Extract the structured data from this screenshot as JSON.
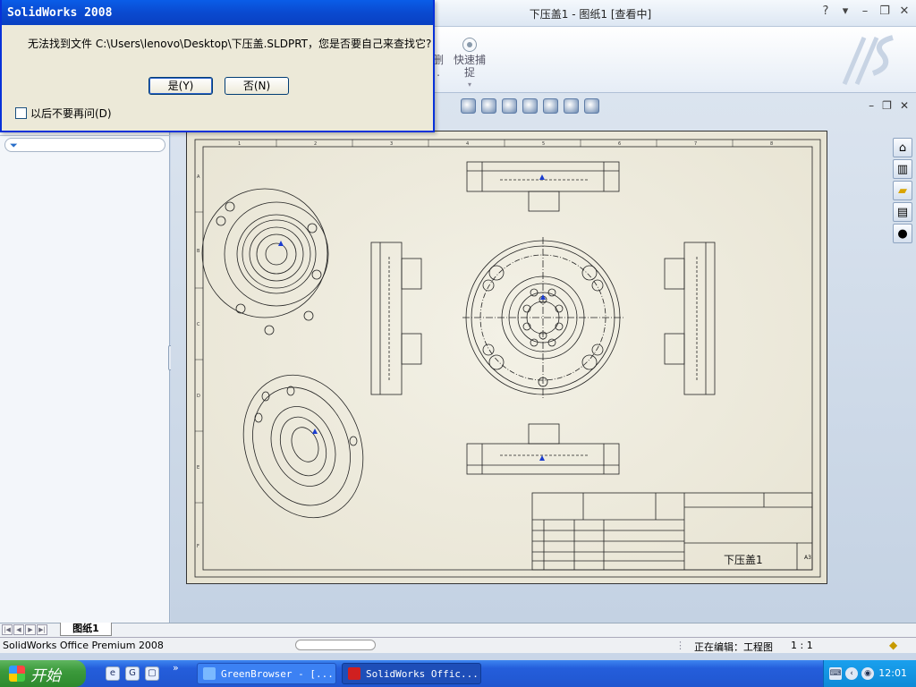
{
  "app": {
    "document_title": "下压盖1 - 图纸1 [查看中]",
    "window_controls": [
      "?",
      "▾",
      "–",
      "❐",
      "✕"
    ]
  },
  "ribbon": {
    "items": [
      {
        "label": "删\n.",
        "icon": "delete-icon"
      },
      {
        "label": "快速捕\n捉",
        "icon": "quick-snap-icon"
      }
    ]
  },
  "dialog": {
    "title": "SolidWorks 2008",
    "message": "无法找到文件 C:\\Users\\lenovo\\Desktop\\下压盖.SLDPRT，您是否要自己来查找它?",
    "yes_label": "是(Y)",
    "no_label": "否(N)",
    "dont_ask_label": "以后不要再问(D)",
    "dont_ask_checked": false
  },
  "graphics": {
    "view_toolbar_icons": [
      "zoom-to-fit-icon",
      "zoom-area-icon",
      "pan-icon",
      "rotate-icon",
      "view-orientation-icon",
      "display-style-icon",
      "hide-show-icon"
    ],
    "window_controls": [
      "–",
      "❐",
      "✕"
    ],
    "task_pane_icons": [
      "home-icon",
      "design-library-icon",
      "file-explorer-icon",
      "view-palette-icon",
      "appearances-icon"
    ]
  },
  "drawing": {
    "title_block_name": "下压盖1",
    "sheet_size": "A3",
    "border_numbers_top": [
      "1",
      "2",
      "3",
      "4",
      "5",
      "6",
      "7",
      "8"
    ],
    "border_letters_side": [
      "A",
      "B",
      "C",
      "D",
      "E",
      "F"
    ]
  },
  "sheet_tabs": {
    "active_tab": "图纸1"
  },
  "status": {
    "product": "SolidWorks Office Premium 2008",
    "editing": "正在编辑：工程图",
    "scale": "1 : 1"
  },
  "taskbar": {
    "start_label": "开始",
    "quick_launch_more": "»",
    "tasks": [
      {
        "label": "GreenBrowser - [...",
        "active": false
      },
      {
        "label": "SolidWorks Offic...",
        "active": true
      }
    ],
    "clock": "12:01"
  }
}
